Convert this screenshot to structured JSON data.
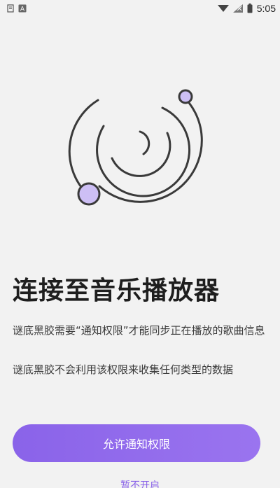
{
  "status_bar": {
    "time": "5:05",
    "left_icons": [
      "notification-icon",
      "app-a-icon"
    ],
    "right_icons": [
      "wifi-icon",
      "signal-icon",
      "battery-icon"
    ]
  },
  "illustration": {
    "icon": "music-connection-illustration-icon",
    "stroke_color": "#3a3a3a",
    "dot_color": "#cdbff5"
  },
  "content": {
    "title": "连接至音乐播放器",
    "description_1": "谜底黑胶需要“通知权限”才能同步正在播放的歌曲信息",
    "description_2": "谜底黑胶不会利用该权限来收集任何类型的数据"
  },
  "actions": {
    "allow_label": "允许通知权限",
    "secondary_label": "暂不开启"
  },
  "colors": {
    "accent": "#8a63e9",
    "background": "#f2f2f2"
  }
}
